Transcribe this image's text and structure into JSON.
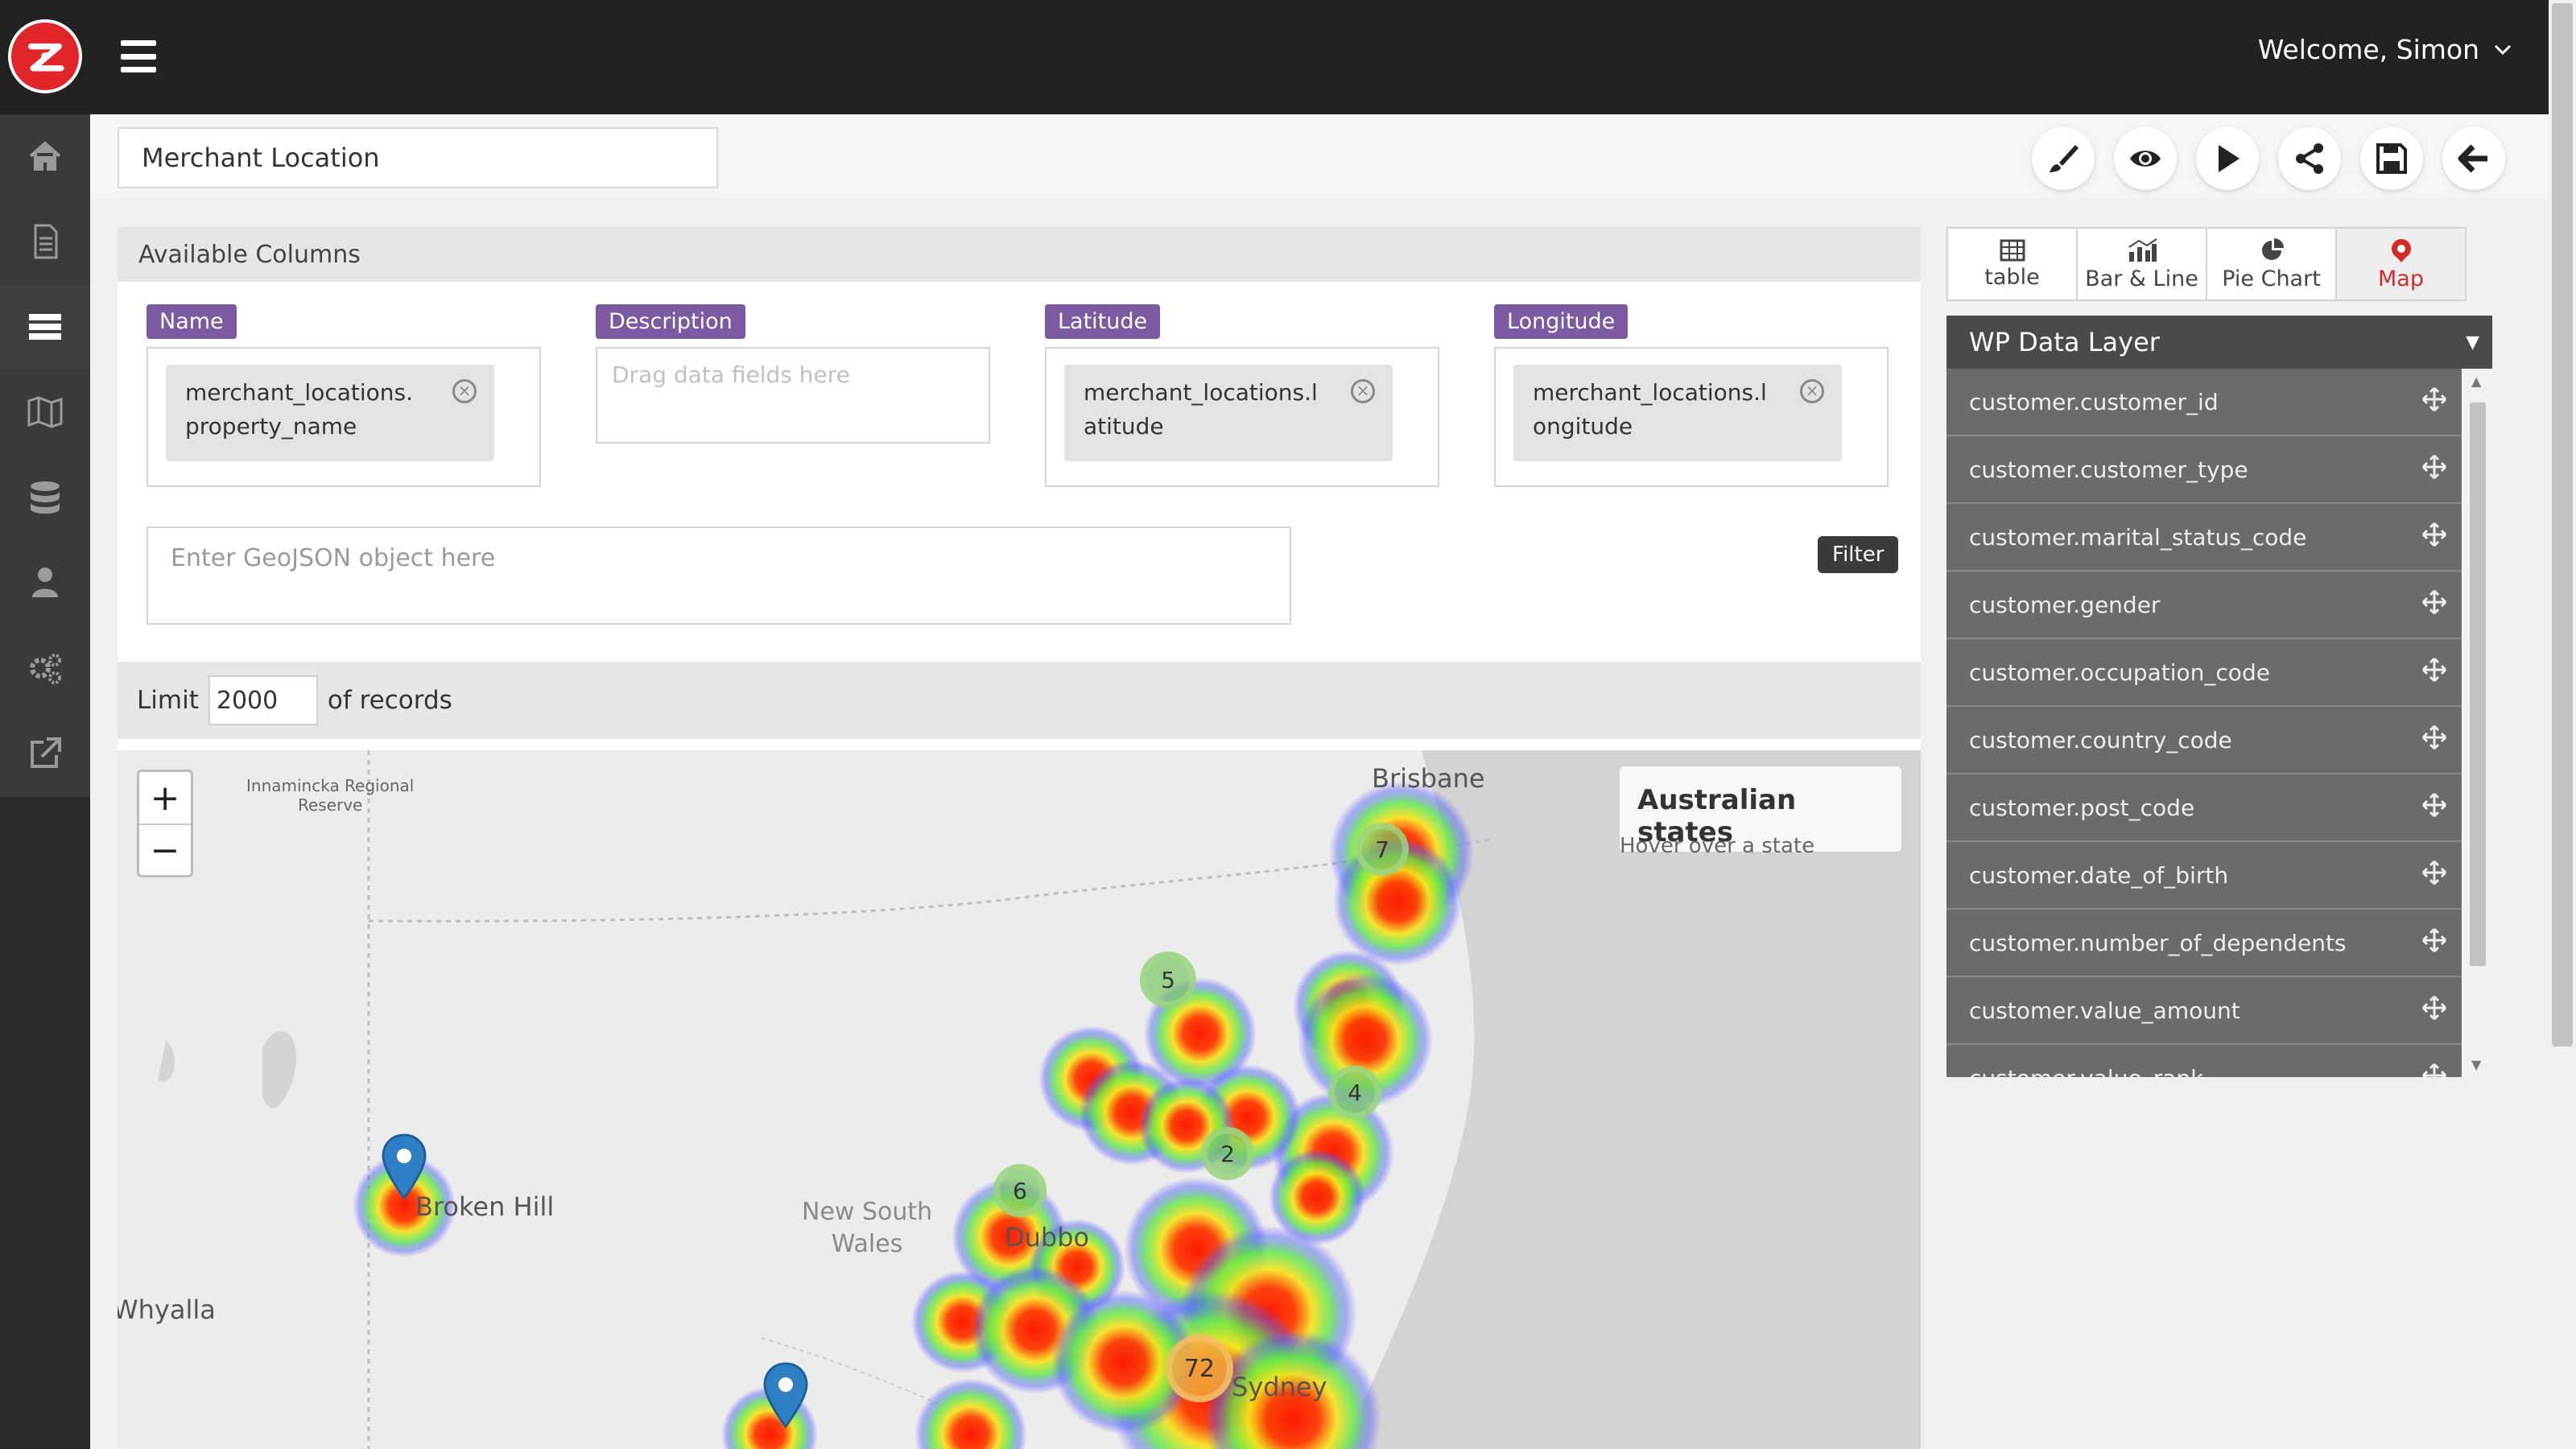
{
  "header": {
    "welcome": "Welcome, Simon"
  },
  "toolbar": {
    "report_title": "Merchant Location"
  },
  "columns": {
    "header": "Available Columns",
    "name": {
      "label": "Name",
      "value": "merchant_locations.\nproperty_name"
    },
    "description": {
      "label": "Description",
      "placeholder": "Drag data fields here"
    },
    "latitude": {
      "label": "Latitude",
      "value": "merchant_locations.l\natitude"
    },
    "longitude": {
      "label": "Longitude",
      "value": "merchant_locations.l\nongitude"
    },
    "geojson_placeholder": "Enter GeoJSON object here",
    "filter_label": "Filter"
  },
  "limit": {
    "label": "Limit",
    "value": "2000",
    "suffix": "of records"
  },
  "map": {
    "info_title": "Australian states",
    "info_sub": "Hover over a state",
    "place_labels": [
      "Brisbane",
      "Broken Hill",
      "New South",
      "Wales",
      "Dubbo",
      "Sydney",
      "Whyalla",
      "Innamincka Regional",
      "Reserve"
    ],
    "clusters": [
      "7",
      "5",
      "4",
      "2",
      "6",
      "72"
    ]
  },
  "viz_tabs": [
    {
      "label": "table",
      "icon": "table-icon"
    },
    {
      "label": "Bar & Line",
      "icon": "bar-chart-icon"
    },
    {
      "label": "Pie Chart",
      "icon": "pie-chart-icon"
    },
    {
      "label": "Map",
      "icon": "map-pin-icon"
    }
  ],
  "data_layer": {
    "title": "WP Data Layer",
    "items": [
      "customer.customer_id",
      "customer.customer_type",
      "customer.marital_status_code",
      "customer.gender",
      "customer.occupation_code",
      "customer.country_code",
      "customer.post_code",
      "customer.date_of_birth",
      "customer.number_of_dependents",
      "customer.value_amount",
      "customer.value_rank"
    ]
  },
  "colors": {
    "topbar": "#222222",
    "tag_purple": "#7a5aa0",
    "accent_red": "#d52a2a",
    "layer_item": "#6b6b6b"
  }
}
